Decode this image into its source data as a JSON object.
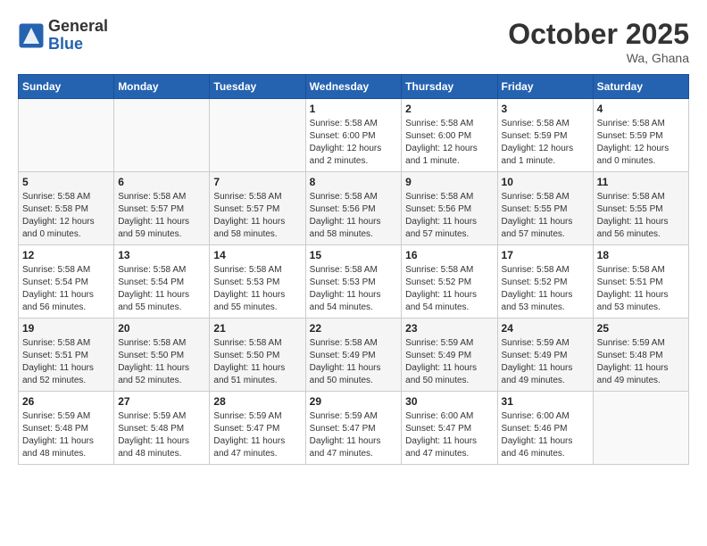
{
  "header": {
    "logo_general": "General",
    "logo_blue": "Blue",
    "month": "October 2025",
    "location": "Wa, Ghana"
  },
  "days_of_week": [
    "Sunday",
    "Monday",
    "Tuesday",
    "Wednesday",
    "Thursday",
    "Friday",
    "Saturday"
  ],
  "weeks": [
    [
      {
        "day": "",
        "info": ""
      },
      {
        "day": "",
        "info": ""
      },
      {
        "day": "",
        "info": ""
      },
      {
        "day": "1",
        "info": "Sunrise: 5:58 AM\nSunset: 6:00 PM\nDaylight: 12 hours and 2 minutes."
      },
      {
        "day": "2",
        "info": "Sunrise: 5:58 AM\nSunset: 6:00 PM\nDaylight: 12 hours and 1 minute."
      },
      {
        "day": "3",
        "info": "Sunrise: 5:58 AM\nSunset: 5:59 PM\nDaylight: 12 hours and 1 minute."
      },
      {
        "day": "4",
        "info": "Sunrise: 5:58 AM\nSunset: 5:59 PM\nDaylight: 12 hours and 0 minutes."
      }
    ],
    [
      {
        "day": "5",
        "info": "Sunrise: 5:58 AM\nSunset: 5:58 PM\nDaylight: 12 hours and 0 minutes."
      },
      {
        "day": "6",
        "info": "Sunrise: 5:58 AM\nSunset: 5:57 PM\nDaylight: 11 hours and 59 minutes."
      },
      {
        "day": "7",
        "info": "Sunrise: 5:58 AM\nSunset: 5:57 PM\nDaylight: 11 hours and 58 minutes."
      },
      {
        "day": "8",
        "info": "Sunrise: 5:58 AM\nSunset: 5:56 PM\nDaylight: 11 hours and 58 minutes."
      },
      {
        "day": "9",
        "info": "Sunrise: 5:58 AM\nSunset: 5:56 PM\nDaylight: 11 hours and 57 minutes."
      },
      {
        "day": "10",
        "info": "Sunrise: 5:58 AM\nSunset: 5:55 PM\nDaylight: 11 hours and 57 minutes."
      },
      {
        "day": "11",
        "info": "Sunrise: 5:58 AM\nSunset: 5:55 PM\nDaylight: 11 hours and 56 minutes."
      }
    ],
    [
      {
        "day": "12",
        "info": "Sunrise: 5:58 AM\nSunset: 5:54 PM\nDaylight: 11 hours and 56 minutes."
      },
      {
        "day": "13",
        "info": "Sunrise: 5:58 AM\nSunset: 5:54 PM\nDaylight: 11 hours and 55 minutes."
      },
      {
        "day": "14",
        "info": "Sunrise: 5:58 AM\nSunset: 5:53 PM\nDaylight: 11 hours and 55 minutes."
      },
      {
        "day": "15",
        "info": "Sunrise: 5:58 AM\nSunset: 5:53 PM\nDaylight: 11 hours and 54 minutes."
      },
      {
        "day": "16",
        "info": "Sunrise: 5:58 AM\nSunset: 5:52 PM\nDaylight: 11 hours and 54 minutes."
      },
      {
        "day": "17",
        "info": "Sunrise: 5:58 AM\nSunset: 5:52 PM\nDaylight: 11 hours and 53 minutes."
      },
      {
        "day": "18",
        "info": "Sunrise: 5:58 AM\nSunset: 5:51 PM\nDaylight: 11 hours and 53 minutes."
      }
    ],
    [
      {
        "day": "19",
        "info": "Sunrise: 5:58 AM\nSunset: 5:51 PM\nDaylight: 11 hours and 52 minutes."
      },
      {
        "day": "20",
        "info": "Sunrise: 5:58 AM\nSunset: 5:50 PM\nDaylight: 11 hours and 52 minutes."
      },
      {
        "day": "21",
        "info": "Sunrise: 5:58 AM\nSunset: 5:50 PM\nDaylight: 11 hours and 51 minutes."
      },
      {
        "day": "22",
        "info": "Sunrise: 5:58 AM\nSunset: 5:49 PM\nDaylight: 11 hours and 50 minutes."
      },
      {
        "day": "23",
        "info": "Sunrise: 5:59 AM\nSunset: 5:49 PM\nDaylight: 11 hours and 50 minutes."
      },
      {
        "day": "24",
        "info": "Sunrise: 5:59 AM\nSunset: 5:49 PM\nDaylight: 11 hours and 49 minutes."
      },
      {
        "day": "25",
        "info": "Sunrise: 5:59 AM\nSunset: 5:48 PM\nDaylight: 11 hours and 49 minutes."
      }
    ],
    [
      {
        "day": "26",
        "info": "Sunrise: 5:59 AM\nSunset: 5:48 PM\nDaylight: 11 hours and 48 minutes."
      },
      {
        "day": "27",
        "info": "Sunrise: 5:59 AM\nSunset: 5:48 PM\nDaylight: 11 hours and 48 minutes."
      },
      {
        "day": "28",
        "info": "Sunrise: 5:59 AM\nSunset: 5:47 PM\nDaylight: 11 hours and 47 minutes."
      },
      {
        "day": "29",
        "info": "Sunrise: 5:59 AM\nSunset: 5:47 PM\nDaylight: 11 hours and 47 minutes."
      },
      {
        "day": "30",
        "info": "Sunrise: 6:00 AM\nSunset: 5:47 PM\nDaylight: 11 hours and 47 minutes."
      },
      {
        "day": "31",
        "info": "Sunrise: 6:00 AM\nSunset: 5:46 PM\nDaylight: 11 hours and 46 minutes."
      },
      {
        "day": "",
        "info": ""
      }
    ]
  ]
}
